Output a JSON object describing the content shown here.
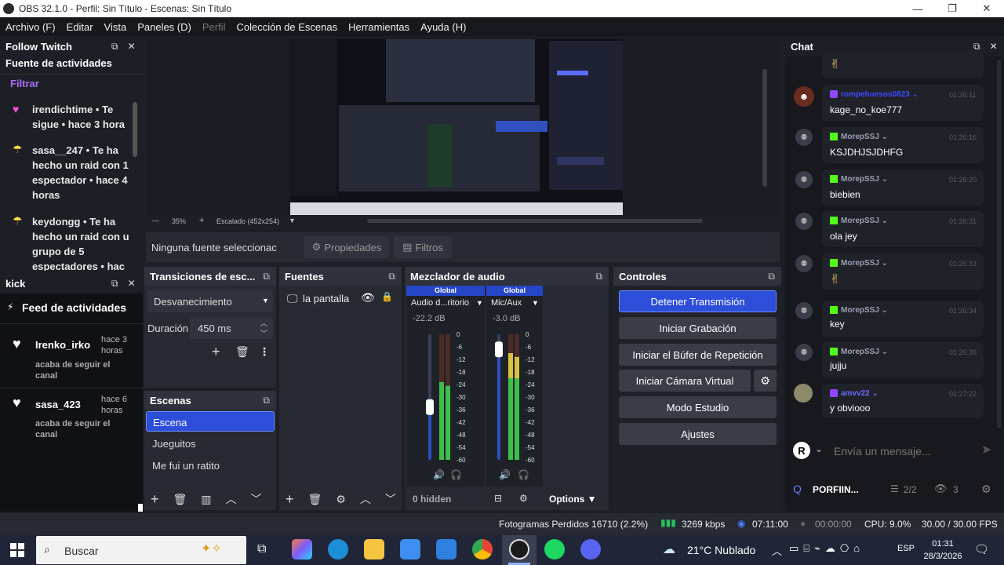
{
  "window": {
    "title": "OBS 32.1.0 - Perfil: Sin Título - Escenas: Sin Título"
  },
  "menu": [
    {
      "label": "Archivo (F)",
      "enabled": true
    },
    {
      "label": "Editar",
      "enabled": true
    },
    {
      "label": "Vista",
      "enabled": true
    },
    {
      "label": "Paneles (D)",
      "enabled": true
    },
    {
      "label": "Perfil",
      "enabled": false
    },
    {
      "label": "Colección de Escenas",
      "enabled": true
    },
    {
      "label": "Herramientas",
      "enabled": true
    },
    {
      "label": "Ayuda (H)",
      "enabled": true
    }
  ],
  "follow_twitch": {
    "title": "Follow Twitch",
    "subtitle": "Fuente de actividades",
    "filter_label": "Filtrar",
    "items": [
      {
        "text_lines": [
          "irendichtime • Te",
          "sigue • hace 3 hora"
        ],
        "icon": "heart-icon",
        "color": "#ff4fd8"
      },
      {
        "text_lines": [
          "sasa__247 • Te ha",
          "hecho un raid con 1",
          "espectador • hace 4",
          "horas"
        ],
        "icon": "parachute-icon",
        "color": "#ffe24a"
      },
      {
        "text_lines": [
          "keydongg • Te ha",
          "hecho un raid con u",
          "grupo de 5",
          "espectadores • hac"
        ],
        "icon": "parachute-icon",
        "color": "#ffe24a"
      }
    ]
  },
  "kick": {
    "title": "kick",
    "feed_label": "Feed de actividades",
    "items": [
      {
        "name": "Irenko_irko",
        "time_lines": [
          "hace 3",
          "horas"
        ],
        "desc_lines": [
          "acaba de seguir el",
          "canal"
        ]
      },
      {
        "name": "sasa_423",
        "time_lines": [
          "hace 6",
          "horas"
        ],
        "desc_lines": [
          "acaba de seguir el",
          "canal"
        ]
      }
    ]
  },
  "preview": {
    "zoom": "35%",
    "scale_label": "Escalado (452x254)",
    "no_source": "Ninguna fuente seleccionac",
    "properties_label": "Propiedades",
    "filters_label": "Filtros"
  },
  "transitions": {
    "title": "Transiciones de esc...",
    "selected": "Desvanecimiento",
    "duration_label": "Duración",
    "duration_value": "450 ms"
  },
  "scenes": {
    "title": "Escenas",
    "items": [
      {
        "label": "Escena",
        "selected": true
      },
      {
        "label": "Jueguitos",
        "selected": false
      },
      {
        "label": "Me fui un ratito",
        "selected": false
      }
    ]
  },
  "sources": {
    "title": "Fuentes",
    "items": [
      {
        "label": "la pantalla"
      }
    ]
  },
  "mixer": {
    "title": "Mezclador de audio",
    "channels": [
      {
        "badge": "Global",
        "name": "Audio d...ritorio",
        "db": "-22.2 dB",
        "level": 0.62,
        "fader": 0.42
      },
      {
        "badge": "Global",
        "name": "Mic/Aux",
        "db": "-3.0 dB",
        "level": 0.85,
        "fader": 0.88
      }
    ],
    "scale": [
      "0",
      "-6",
      "-12",
      "-18",
      "-24",
      "-30",
      "-36",
      "-42",
      "-48",
      "-54",
      "-60"
    ],
    "hidden_label": "0 hidden",
    "options_label": "Options"
  },
  "controls": {
    "title": "Controles",
    "buttons": [
      {
        "label": "Detener Transmisión",
        "active": true
      },
      {
        "label": "Iniciar Grabación",
        "active": false
      },
      {
        "label": "Iniciar el Búfer de Repetición",
        "active": false
      },
      {
        "label": "Iniciar Cámara Virtual",
        "active": false
      },
      {
        "label": "Modo Estudio",
        "active": false
      },
      {
        "label": "Ajustes",
        "active": false
      }
    ]
  },
  "chat": {
    "title": "Chat",
    "messages": [
      {
        "name": "rompehuesos0823",
        "name_color": "#3b4bff",
        "platform": "twitch",
        "time": "01:26:11",
        "text": "kage_no_koe777"
      },
      {
        "name": "MorepSSJ",
        "name_color": "#9aa0b0",
        "platform": "kick",
        "time": "01:26:16",
        "text": "KSJDHJSJDHFG"
      },
      {
        "name": "MorepSSJ",
        "name_color": "#9aa0b0",
        "platform": "kick",
        "time": "01:26:20",
        "text": "biebien"
      },
      {
        "name": "MorepSSJ",
        "name_color": "#9aa0b0",
        "platform": "kick",
        "time": "01:26:31",
        "text": "ola jey"
      },
      {
        "name": "MorepSSJ",
        "name_color": "#9aa0b0",
        "platform": "kick",
        "time": "01:26:33",
        "text": ""
      },
      {
        "name": "MorepSSJ",
        "name_color": "#9aa0b0",
        "platform": "kick",
        "time": "01:26:34",
        "text": "key"
      },
      {
        "name": "MorepSSJ",
        "name_color": "#9aa0b0",
        "platform": "kick",
        "time": "01:26:36",
        "text": "jujju"
      },
      {
        "name": "amvv22",
        "name_color": "#6b6bff",
        "platform": "twitch",
        "time": "01:27:22",
        "text": "y obviooo"
      }
    ],
    "input_placeholder": "Envía un mensaje...",
    "channel_name": "PORFIIN...",
    "channel_count": "2/2",
    "viewers": "3"
  },
  "statusbar": {
    "dropped": "Fotogramas Perdidos 16710 (2.2%)",
    "bitrate": "3269 kbps",
    "stream_time": "07:11:00",
    "rec_time": "00:00:00",
    "cpu": "CPU: 9.0%",
    "fps": "30.00 / 30.00 FPS"
  },
  "taskbar": {
    "search_placeholder": "Buscar",
    "weather": "21°C  Nublado",
    "lang": "ESP",
    "time": "01:31",
    "date": "28/3/2026"
  }
}
